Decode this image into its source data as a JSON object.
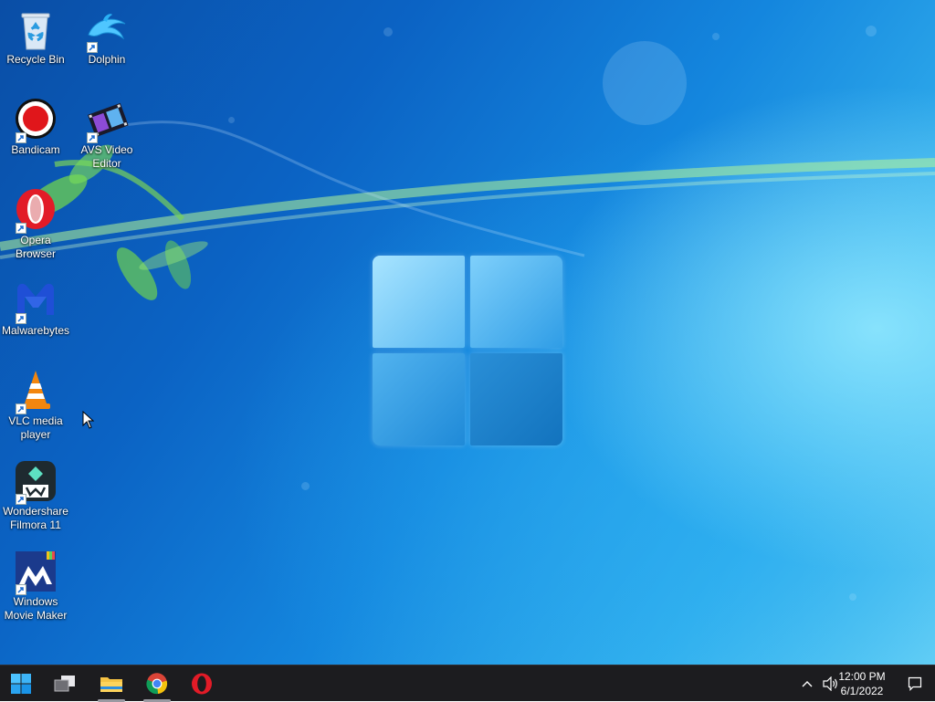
{
  "desktop_icons": [
    {
      "label": "Recycle Bin",
      "icon": "recycle-bin-icon"
    },
    {
      "label": "Dolphin",
      "icon": "dolphin-icon"
    },
    {
      "label": "Bandicam",
      "icon": "bandicam-icon"
    },
    {
      "label": "AVS Video Editor",
      "icon": "avs-video-editor-icon"
    },
    {
      "label": "Opera Browser",
      "icon": "opera-icon"
    },
    {
      "label": "Malwarebytes",
      "icon": "malwarebytes-icon"
    },
    {
      "label": "VLC media player",
      "icon": "vlc-icon"
    },
    {
      "label": "Wondershare Filmora 11",
      "icon": "filmora-icon"
    },
    {
      "label": "Windows Movie Maker",
      "icon": "movie-maker-icon"
    }
  ],
  "taskbar": {
    "items": [
      {
        "name": "start",
        "icon": "windows-start-icon"
      },
      {
        "name": "task-view",
        "icon": "task-view-icon"
      },
      {
        "name": "file-explorer",
        "icon": "folder-icon"
      },
      {
        "name": "chrome",
        "icon": "chrome-icon"
      },
      {
        "name": "opera",
        "icon": "opera-icon"
      }
    ],
    "tray": {
      "time": "12:00 PM",
      "date": "6/1/2022",
      "icons": [
        "chevron-up-icon",
        "speaker-icon",
        "notification-icon"
      ]
    }
  },
  "colors": {
    "taskbar_bg": "#1c1c1f",
    "desktop_dark": "#0a4ea6",
    "desktop_light": "#6fd6f6"
  }
}
